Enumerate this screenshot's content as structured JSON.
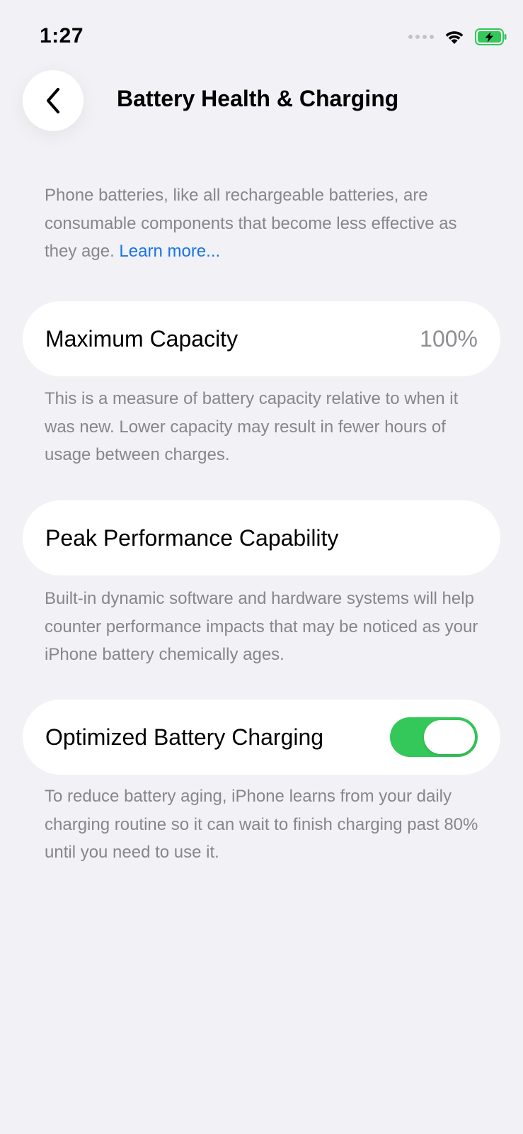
{
  "status_bar": {
    "time": "1:27",
    "icons": [
      "cellular-signal-icon",
      "wifi-icon",
      "battery-charging-icon"
    ]
  },
  "nav": {
    "title": "Battery Health & Charging",
    "back_icon": "chevron-left-icon"
  },
  "intro": {
    "text": "Phone batteries, like all rechargeable batteries, are consumable components that become less effective as they age.",
    "link": "Learn more..."
  },
  "max_capacity": {
    "label": "Maximum Capacity",
    "value": "100%",
    "footnote": "This is a measure of battery capacity relative to when it was new. Lower capacity may result in fewer hours of usage between charges."
  },
  "peak_performance": {
    "label": "Peak Performance Capability",
    "footnote": "Built-in dynamic software and hardware systems will help counter performance impacts that may be noticed as your iPhone battery chemically ages."
  },
  "optimized_charging": {
    "label": "Optimized Battery Charging",
    "enabled": true,
    "footnote": "To reduce battery aging, iPhone learns from your daily charging routine so it can wait to finish charging past 80% until you need to use it."
  },
  "colors": {
    "background": "#f1f1f6",
    "accent_link": "#1a73e8",
    "toggle_on": "#34c759",
    "secondary_text": "#86868b",
    "battery_green": "#34c759"
  }
}
